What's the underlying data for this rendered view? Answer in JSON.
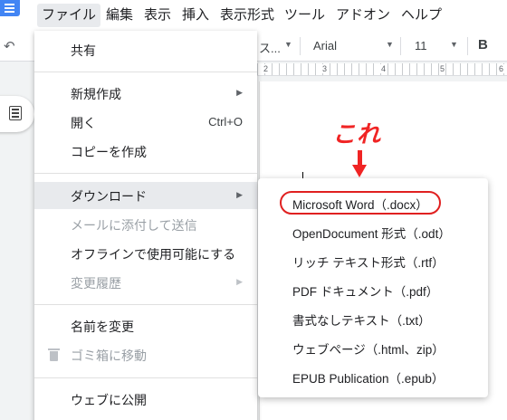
{
  "menubar": {
    "items": [
      "ファイル",
      "編集",
      "表示",
      "挿入",
      "表示形式",
      "ツール",
      "アドオン",
      "ヘルプ"
    ]
  },
  "toolbar": {
    "undo_icon": "undo-icon",
    "style_label": "ス...",
    "font": "Arial",
    "font_size": "11",
    "bold_label": "B"
  },
  "ruler": {
    "numbers": [
      "2",
      "3",
      "4",
      "5",
      "6"
    ]
  },
  "file_menu": {
    "items": [
      {
        "label": "共有",
        "shortcut": "",
        "submenu": false,
        "disabled": false
      },
      {
        "label": "新規作成",
        "shortcut": "",
        "submenu": true,
        "disabled": false
      },
      {
        "label": "開く",
        "shortcut": "Ctrl+O",
        "submenu": false,
        "disabled": false
      },
      {
        "label": "コピーを作成",
        "shortcut": "",
        "submenu": false,
        "disabled": false
      },
      {
        "label": "ダウンロード",
        "shortcut": "",
        "submenu": true,
        "disabled": false
      },
      {
        "label": "メールに添付して送信",
        "shortcut": "",
        "submenu": false,
        "disabled": true
      },
      {
        "label": "オフラインで使用可能にする",
        "shortcut": "",
        "submenu": false,
        "disabled": false
      },
      {
        "label": "変更履歴",
        "shortcut": "",
        "submenu": true,
        "disabled": true
      },
      {
        "label": "名前を変更",
        "shortcut": "",
        "submenu": false,
        "disabled": false
      },
      {
        "label": "ゴミ箱に移動",
        "shortcut": "",
        "submenu": false,
        "disabled": true
      },
      {
        "label": "ウェブに公開",
        "shortcut": "",
        "submenu": false,
        "disabled": false
      }
    ]
  },
  "download_submenu": {
    "items": [
      "Microsoft Word（.docx）",
      "OpenDocument 形式（.odt）",
      "リッチ テキスト形式（.rtf）",
      "PDF ドキュメント（.pdf）",
      "書式なしテキスト（.txt）",
      "ウェブページ（.html、zip）",
      "EPUB Publication（.epub）"
    ]
  },
  "annotation": {
    "text": "これ",
    "color": "#f02424"
  },
  "colors": {
    "accent": "#4285f4",
    "highlight": "#e8eaed",
    "annotation_red": "#f02424"
  }
}
